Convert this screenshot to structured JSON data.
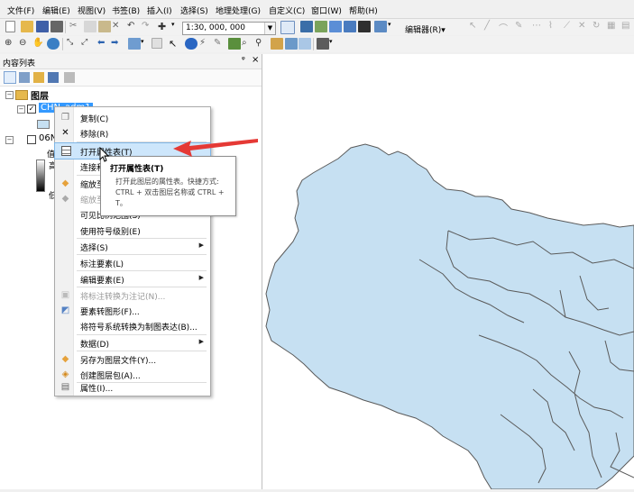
{
  "menubar": {
    "items": [
      "文件(F)",
      "编辑(E)",
      "视图(V)",
      "书签(B)",
      "插入(I)",
      "选择(S)",
      "地理处理(G)",
      "自定义(C)",
      "窗口(W)",
      "帮助(H)"
    ]
  },
  "toolbar": {
    "scale_value": "1:30, 000, 000",
    "editor_label": "编辑器(R)▾"
  },
  "toc": {
    "title": "内容列表",
    "pin": "ᵠ",
    "close": "×",
    "layers_label": "图层",
    "layer1_name": "CHN_adm1",
    "layer2_name": "06N",
    "legend_frag1": "值",
    "legend_frag2": "高",
    "legend_frag3": "低"
  },
  "context_menu": {
    "items": [
      {
        "label": "复制(C)",
        "icon": "copy-icon"
      },
      {
        "label": "移除(R)",
        "icon": "remove-icon"
      },
      {
        "label": "打开属性表(T)",
        "icon": "table-icon",
        "highlighted": true
      },
      {
        "label": "连接和关联(J)",
        "icon": "",
        "submenu": true
      },
      {
        "label": "缩放至图层(Z)",
        "icon": "zoom-layer-icon"
      },
      {
        "label": "缩放至可见",
        "icon": "zoom-visible-icon",
        "disabled": true
      },
      {
        "label": "可见比例范围(S)",
        "icon": "",
        "submenu": true
      },
      {
        "label": "使用符号级别(E)",
        "icon": ""
      },
      {
        "label": "选择(S)",
        "icon": "",
        "submenu": true
      },
      {
        "label": "标注要素(L)",
        "icon": ""
      },
      {
        "label": "编辑要素(E)",
        "icon": "",
        "submenu": true
      },
      {
        "label": "将标注转换为注记(N)...",
        "icon": "convert-labels-icon",
        "disabled": true
      },
      {
        "label": "要素转图形(F)...",
        "icon": "features-to-graphics-icon"
      },
      {
        "label": "将符号系统转换为制图表达(B)...",
        "icon": ""
      },
      {
        "label": "数据(D)",
        "icon": "",
        "submenu": true
      },
      {
        "label": "另存为图层文件(Y)...",
        "icon": "save-layer-icon"
      },
      {
        "label": "创建图层包(A)...",
        "icon": "layer-package-icon"
      },
      {
        "label": "属性(I)...",
        "icon": "properties-icon"
      }
    ]
  },
  "tooltip": {
    "title": "打开属性表(T)",
    "body": "打开此图层的属性表。快捷方式: CTRL + 双击图层名称或 CTRL + T。"
  },
  "colors": {
    "map_fill": "#c6e0f2",
    "map_stroke": "#5a5a5a",
    "selection": "#3399ff",
    "arrow": "#e53935"
  }
}
